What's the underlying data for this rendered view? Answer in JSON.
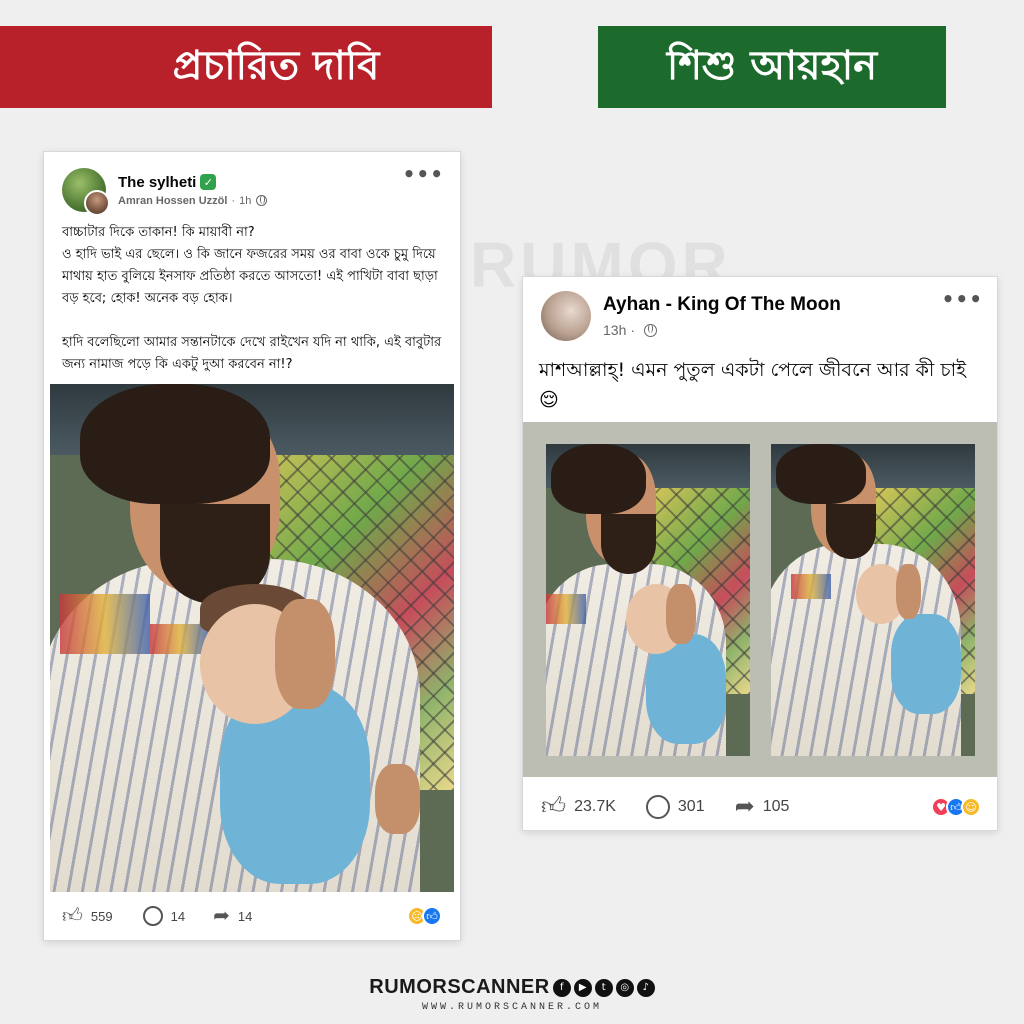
{
  "banners": {
    "left": "প্রচারিত দাবি",
    "right": "শিশু আয়হান"
  },
  "watermark": "RUMOR",
  "left_post": {
    "page_name": "The sylheti",
    "author": "Amran Hossen Uzzöl",
    "time": "1h",
    "text": "বাচ্চাটার দিকে তাকান! কি মায়াবী না?\nও হাদি ভাই এর ছেলে। ও কি জানে ফজরের সময় ওর বাবা ওকে চুমু দিয়ে মাথায় হাত বুলিয়ে ইনসাফ প্রতিষ্ঠা করতে আসতো! এই পাখিটা বাবা ছাড়া বড় হবে; হোক! অনেক বড় হোক।\n\nহাদি বলেছিলো আমার সন্তানটাকে দেখে রাইখেন যদি না থাকি, এই বাবুটার জন্য নামাজ পড়ে কি একটু দুআ করবেন না!?",
    "likes": "559",
    "comments": "14",
    "shares": "14"
  },
  "right_post": {
    "page_name": "Ayhan - King Of The Moon",
    "time": "13h",
    "text": "মাশআল্লাহ্! এমন পুতুল একটা পেলে জীবনে আর কী চাই 😌",
    "likes": "23.7K",
    "comments": "301",
    "shares": "105"
  },
  "footer": {
    "brand": "RUMORSCANNER",
    "site": "WWW.RUMORSCANNER.COM"
  },
  "colors": {
    "banner_red": "#b8202a",
    "banner_green": "#1d6a2d",
    "verified_green": "#31a24c",
    "fb_blue": "#1877f2"
  },
  "icons": {
    "social": [
      "facebook-icon",
      "youtube-icon",
      "twitter-icon",
      "instagram-icon",
      "tiktok-icon"
    ]
  }
}
